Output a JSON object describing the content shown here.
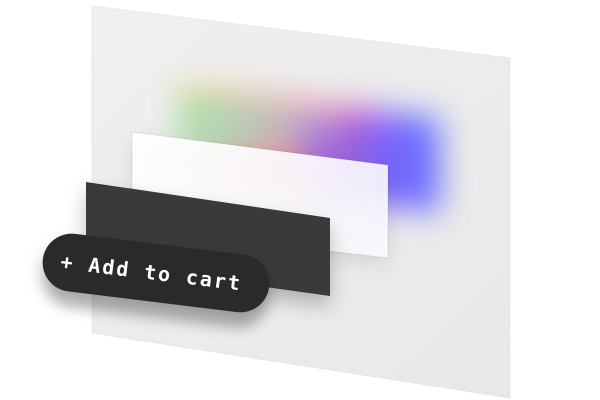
{
  "cta": {
    "label": "+ Add to cart"
  },
  "colors": {
    "panel": "#f1f1f1",
    "card_white": "#fbfbfb",
    "card_dark": "#3a3a3a",
    "pill": "#2a2a2a",
    "pill_text": "#ffffff",
    "gradient": [
      "#ffd24a",
      "#ff5a6e",
      "#7a5cff",
      "#44d7a8",
      "#4fa8ff"
    ]
  },
  "icons": {
    "plus": "plus-icon"
  }
}
